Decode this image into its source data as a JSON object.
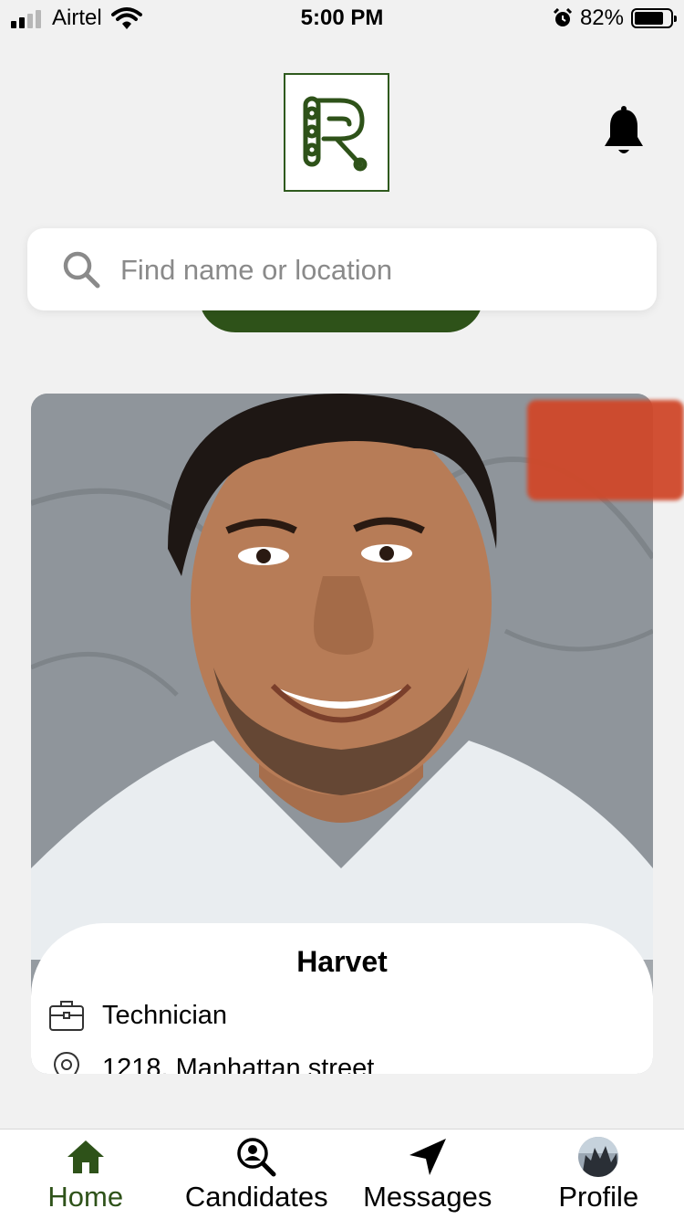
{
  "status_bar": {
    "carrier": "Airtel",
    "time": "5:00 PM",
    "battery_percent": "82%",
    "battery_level": 0.82,
    "icons": [
      "signal-icon",
      "wifi-icon",
      "alarm-icon",
      "battery-icon"
    ]
  },
  "header": {
    "logo_icon": "r-logo-icon",
    "notification_icon": "bell-icon"
  },
  "search": {
    "placeholder": "Find name or location",
    "value": ""
  },
  "candidate": {
    "name": "Harvet",
    "job_title": "Technician",
    "address": "1218, Manhattan street",
    "photo_icon": "candidate-photo"
  },
  "tabs": [
    {
      "label": "Home",
      "icon": "home-icon",
      "active": true
    },
    {
      "label": "Candidates",
      "icon": "candidate-search-icon",
      "active": false
    },
    {
      "label": "Messages",
      "icon": "send-arrow-icon",
      "active": false
    },
    {
      "label": "Profile",
      "icon": "avatar",
      "active": false
    }
  ],
  "colors": {
    "brand_green": "#2e5219",
    "accent_orange": "#d0482a",
    "background": "#f1f1f1"
  }
}
